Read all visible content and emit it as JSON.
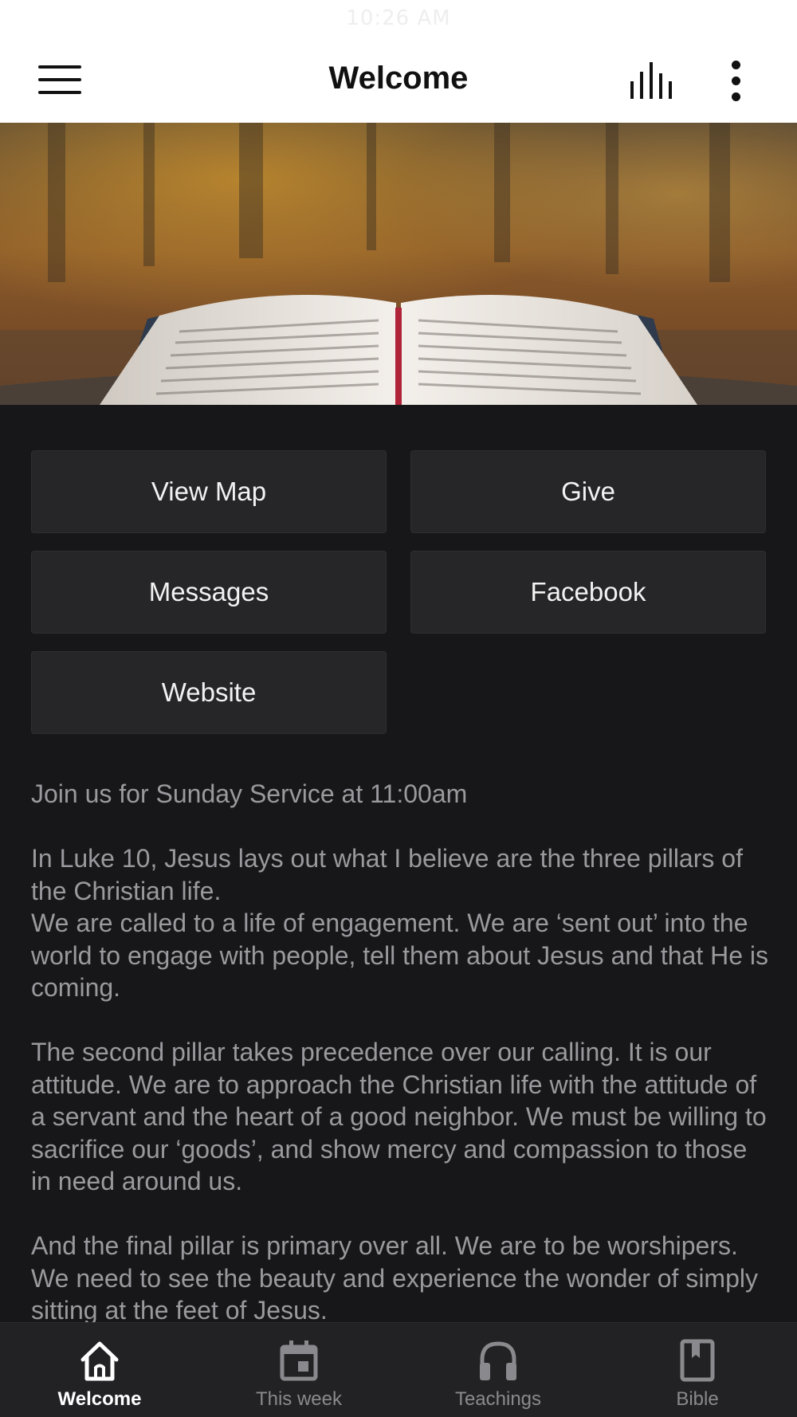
{
  "status_bar": {
    "time": "10:26 AM"
  },
  "header": {
    "title": "Welcome"
  },
  "hero": {
    "alt": "open bible"
  },
  "buttons": [
    {
      "label": "View Map"
    },
    {
      "label": "Give"
    },
    {
      "label": "Messages"
    },
    {
      "label": "Facebook"
    },
    {
      "label": "Website"
    }
  ],
  "content": {
    "paragraphs": [
      "Join us for Sunday Service at 11:00am",
      "In Luke 10, Jesus lays out what I believe are the three pillars of the Christian life.\nWe are called to a life of engagement. We are ‘sent out’ into the world to engage with people, tell them about Jesus and that He is coming.",
      "The second pillar takes precedence over our calling. It is our attitude. We are to approach the Christian life with the attitude of a servant and the heart of a good neighbor. We must be willing to sacrifice our ‘goods’, and show mercy and compassion to those in need around us.",
      "And the final pillar is primary over all. We are to be worshipers. We need to see the beauty and experience the wonder of simply sitting at the feet of Jesus."
    ]
  },
  "bottom_nav": {
    "items": [
      {
        "label": "Welcome",
        "icon": "home-icon",
        "active": true
      },
      {
        "label": "This week",
        "icon": "calendar-icon",
        "active": false
      },
      {
        "label": "Teachings",
        "icon": "headphones-icon",
        "active": false
      },
      {
        "label": "Bible",
        "icon": "bookmark-book-icon",
        "active": false
      }
    ]
  },
  "colors": {
    "appbar": "#ffffff",
    "background": "#17171a",
    "button": "#262628",
    "body_text": "#9a9a9e",
    "nav_active": "#ffffff",
    "nav_inactive": "#8a8a8e"
  }
}
